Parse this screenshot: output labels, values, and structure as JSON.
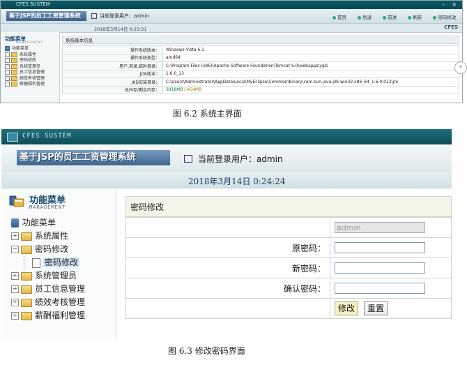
{
  "shot1": {
    "window_title": "CFES SUSTEM",
    "window_buttons": "- ×",
    "system_title": "基于JSP的员工工资管理系统",
    "current_user_label": "当前登录用户：admin",
    "nav": [
      "首页",
      "后退",
      "前进",
      "刷新",
      "密码修改",
      "退出"
    ],
    "datetime": "2018年3月14日  0:23:31",
    "brand": "CFES",
    "menu_title": "功能菜单",
    "menu_subtitle": "MANAGEMENT",
    "tree_root": "功能菜单",
    "tree_items": [
      "系统属性",
      "密码修改",
      "系统管理员",
      "员工信息管理",
      "绩效考核管理",
      "薪酬福利管理"
    ],
    "panel_title": "系统基本信息",
    "info_rows": [
      {
        "label": "操作系统版本：",
        "value": "Windows Vista  6.1"
      },
      {
        "label": "操作系统类型：",
        "value": "amd64"
      },
      {
        "label": "用户,目录,临时目录：",
        "value": "C:\\Program Files (x86)\\Apache Software Foundation\\Tomcat 6.0\\webapps\\ygzi"
      },
      {
        "label": "JDK版本：",
        "value": "1.6.0_13"
      },
      {
        "label": "JKD安装目录：",
        "value": "C:\\Users\\Administrator\\AppData\\Local\\MyEclipse\\Common\\binary\\com.sun.java.jdk.win32.x86_64_1.6.0.013\\jre"
      }
    ],
    "memory_label": "总内存/剩余内存：",
    "memory_total": "3818MB",
    "memory_sep": " / ",
    "memory_free": "454MB"
  },
  "caption1": "图 6.2   系统主界面",
  "shot2": {
    "window_title": "CFES SUSTEM",
    "system_title": "基于JSP的员工工资管理系统",
    "current_user_label": "当前登录用户：admin",
    "datetime": "2018年3月14日   0:24:24",
    "menu_title": "功能菜单",
    "menu_subtitle": "MANAGEMENT",
    "tree_root": "功能菜单",
    "tree": {
      "item1": "系统属性",
      "item2": "密码修改",
      "item2_child": "密码修改",
      "item3": "系统管理员",
      "item4": "员工信息管理",
      "item5": "绩效考核管理",
      "item6": "薪酬福利管理"
    },
    "panel_title": "密码修改",
    "username_value": "admin",
    "old_password_label": "原密码：",
    "new_password_label": "新密码：",
    "confirm_password_label": "确认密码：",
    "submit_label": "修改",
    "reset_label": "重置"
  },
  "caption2": "图 6.3   修改密码界面",
  "colors": {
    "titlebar": "#0e4d59",
    "logo_band": "#3e6591",
    "menu_title": "#13466a",
    "memory_total": "#1a7f2e",
    "memory_free": "#b86b00"
  }
}
